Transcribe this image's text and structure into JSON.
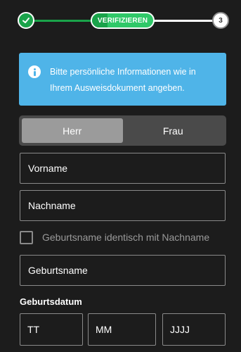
{
  "stepper": {
    "steps": [
      {
        "state": "done",
        "icon": "check-icon"
      },
      {
        "state": "active",
        "label": "VERIFIZIEREN"
      },
      {
        "state": "todo",
        "number": "3"
      }
    ],
    "colors": {
      "done": "#1aa34a",
      "active": "#2fc868",
      "todo_line": "#ffffff"
    }
  },
  "info": {
    "icon": "info-icon",
    "text": "Bitte persönliche Informationen wie in Ihrem Ausweisdokument angeben.",
    "color": "#4fb4e8"
  },
  "gender": {
    "options": [
      "Herr",
      "Frau"
    ],
    "selected": "Herr"
  },
  "form": {
    "vorname_placeholder": "Vorname",
    "nachname_placeholder": "Nachname",
    "same_birthname_label": "Geburtsname identisch mit Nachname",
    "same_birthname_checked": false,
    "geburtsname_placeholder": "Geburtsname",
    "birthdate_label": "Geburtsdatum",
    "day_placeholder": "TT",
    "month_placeholder": "MM",
    "year_placeholder": "JJJJ"
  }
}
